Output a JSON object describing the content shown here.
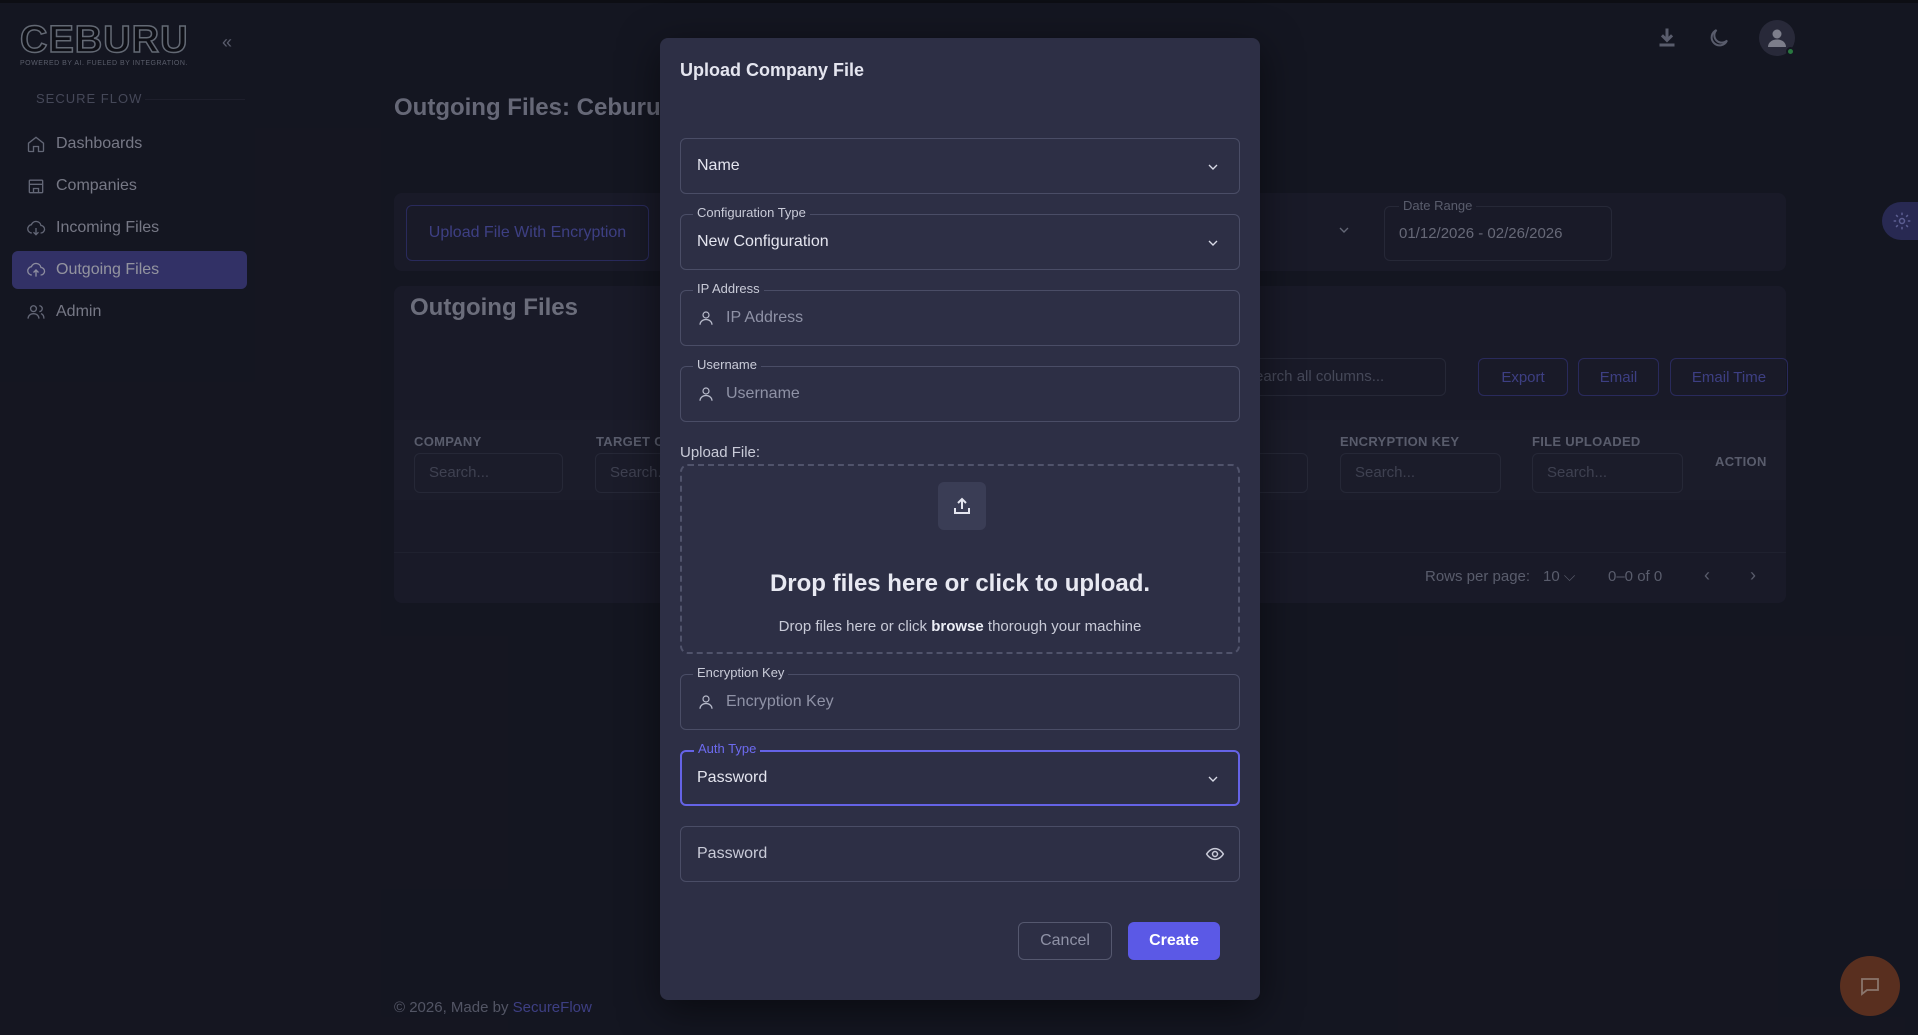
{
  "logo": {
    "text": "CEBURU",
    "tagline": "POWERED BY AI. FUELED BY INTEGRATION."
  },
  "sidebar": {
    "section_label": "SECURE FLOW",
    "items": [
      {
        "label": "Dashboards",
        "icon": "home-icon"
      },
      {
        "label": "Companies",
        "icon": "building-icon"
      },
      {
        "label": "Incoming Files",
        "icon": "cloud-download-icon"
      },
      {
        "label": "Outgoing Files",
        "icon": "cloud-upload-icon",
        "active": true
      },
      {
        "label": "Admin",
        "icon": "users-icon"
      }
    ]
  },
  "header": {
    "icons": [
      "download-icon",
      "moon-icon",
      "user-avatar"
    ]
  },
  "page": {
    "title": "Outgoing Files: Ceburu",
    "upload_button": "Upload File With Encryption",
    "date_range": {
      "label": "Date Range",
      "value": "01/12/2026 - 02/26/2026"
    },
    "table": {
      "title": "Outgoing Files",
      "search_placeholder": "Search all columns...",
      "buttons": [
        "Export",
        "Email",
        "Email Time"
      ],
      "columns": [
        "COMPANY",
        "TARGET C",
        "ENCRYPTION KEY",
        "FILE UPLOADED",
        "ACTION"
      ],
      "column_search_placeholder": "Search...",
      "rows_per_page_label": "Rows per page:",
      "rows_per_page": "10",
      "range": "0–0 of 0"
    },
    "footer": {
      "text": "© 2026, Made by ",
      "link": "SecureFlow"
    }
  },
  "modal": {
    "title": "Upload Company File",
    "name_select": {
      "value": "Name"
    },
    "config_type": {
      "label": "Configuration Type",
      "value": "New Configuration"
    },
    "ip_address": {
      "label": "IP Address",
      "placeholder": "IP Address"
    },
    "username": {
      "label": "Username",
      "placeholder": "Username"
    },
    "upload": {
      "label": "Upload File:",
      "title": "Drop files here or click to upload.",
      "sub_before": "Drop files here or click ",
      "sub_link": "browse",
      "sub_after": " thorough your machine"
    },
    "encryption_key": {
      "label": "Encryption Key",
      "placeholder": "Encryption Key"
    },
    "auth_type": {
      "label": "Auth Type",
      "value": "Password"
    },
    "password": {
      "placeholder": "Password"
    },
    "cancel_label": "Cancel",
    "create_label": "Create"
  },
  "colors": {
    "accent": "#5b59e6",
    "active_nav": "#4b4a9a",
    "background": "#1b1d2b",
    "modal": "#2d2f45"
  }
}
